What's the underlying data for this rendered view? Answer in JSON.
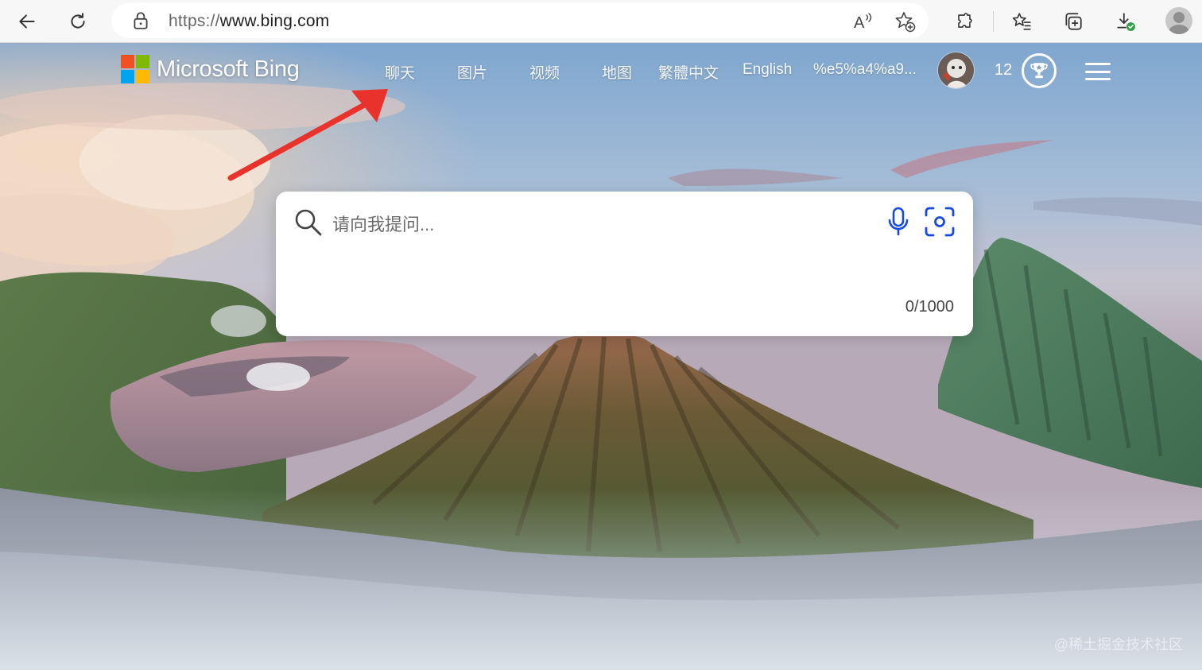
{
  "browser": {
    "url_scheme": "https://",
    "url_host": "www.bing.com",
    "icons": [
      "back-icon",
      "refresh-icon",
      "lock-icon",
      "read-aloud-icon",
      "add-favorite-icon",
      "extensions-icon",
      "favorites-icon",
      "collections-icon",
      "downloads-icon",
      "profile-icon"
    ]
  },
  "header": {
    "logo_text": "Microsoft Bing",
    "logo_colors": [
      "#f25022",
      "#7fba00",
      "#00a4ef",
      "#ffb900"
    ],
    "nav": [
      "聊天",
      "图片",
      "视频",
      "地图",
      "繁體中文",
      "English",
      "%e5%a4%a9..."
    ],
    "points": "12",
    "icons": [
      "avatar",
      "rewards-trophy-icon",
      "hamburger-menu-icon"
    ]
  },
  "search": {
    "placeholder": "请向我提问...",
    "counter": "0/1000",
    "accent_color": "#174ae4",
    "icons": [
      "search-icon",
      "microphone-icon",
      "visual-search-icon"
    ]
  },
  "annotation": {
    "color": "#e8322b",
    "points_to": "聊天"
  },
  "watermark": "@稀土掘金技术社区"
}
